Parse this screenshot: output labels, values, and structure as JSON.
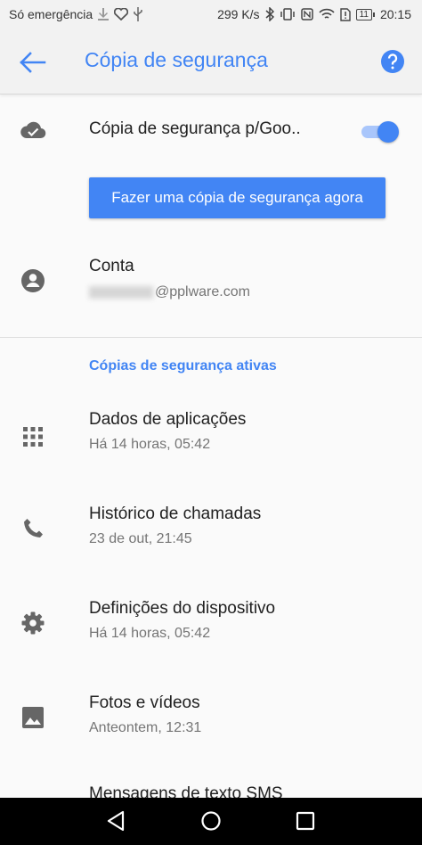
{
  "status_bar": {
    "carrier": "Só emergência",
    "speed": "299 K/s",
    "battery": "11",
    "time": "20:15"
  },
  "app_bar": {
    "title": "Cópia de segurança",
    "accent_color": "#4285f4"
  },
  "google_backup": {
    "label": "Cópia de segurança p/Goo..",
    "toggle_on": true
  },
  "backup_button_label": "Fazer uma cópia de segurança agora",
  "account": {
    "title": "Conta",
    "email_suffix": "@pplware.com"
  },
  "active_section": {
    "header": "Cópias de segurança ativas",
    "items": [
      {
        "title": "Dados de aplicações",
        "subtitle": "Há 14 horas, 05:42",
        "icon": "apps-grid-icon"
      },
      {
        "title": "Histórico de chamadas",
        "subtitle": "23 de out, 21:45",
        "icon": "phone-icon"
      },
      {
        "title": "Definições do dispositivo",
        "subtitle": "Há 14 horas, 05:42",
        "icon": "settings-gear-icon"
      },
      {
        "title": "Fotos e vídeos",
        "subtitle": "Anteontem, 12:31",
        "icon": "photo-icon"
      },
      {
        "title": "Mensagens de texto SMS",
        "subtitle": "",
        "icon": ""
      }
    ]
  }
}
